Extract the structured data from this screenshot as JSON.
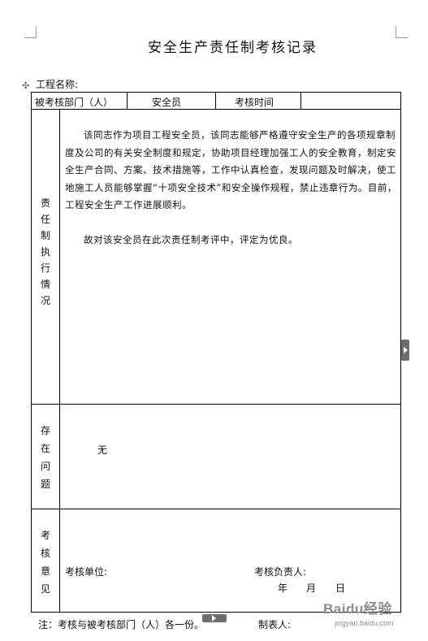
{
  "title": "安全生产责任制考核记录",
  "project_label": "工程名称:",
  "header_row": {
    "dept_label": "被考核部门（人）",
    "dept_value": "安全员",
    "time_label": "考核时间",
    "time_value": ""
  },
  "section_execution": {
    "label": "责任制执行情况",
    "paragraph_1": "该同志作为项目工程安全员，该同志能够严格遵守安全生产的各项规章制度及公司的有关安全制度和规定，协助项目经理加强工人的安全教育，制定安全生产合同、方案、技术措施等，工作中认真检查，发现问题及时解决，使工地施工人员能够掌握“十项安全技术”和安全操作规程，禁止违章行为。目前，工程安全生产工作进展顺利。",
    "paragraph_2": "故对该安全员在此次责任制考评中，评定为优良。"
  },
  "section_issues": {
    "label": "存在问题",
    "value": "无"
  },
  "section_opinion": {
    "label": "考核意见",
    "unit_label": "考核单位:",
    "responsible_label": "考核负责人:",
    "date_year": "年",
    "date_month": "月",
    "date_day": "日"
  },
  "footer": {
    "note": "注：考核与被考核部门（人）各一份。",
    "preparer_label": "制表人:"
  },
  "watermark": {
    "brand": "Baidu经验",
    "url": "jingyan.baidu.com"
  }
}
